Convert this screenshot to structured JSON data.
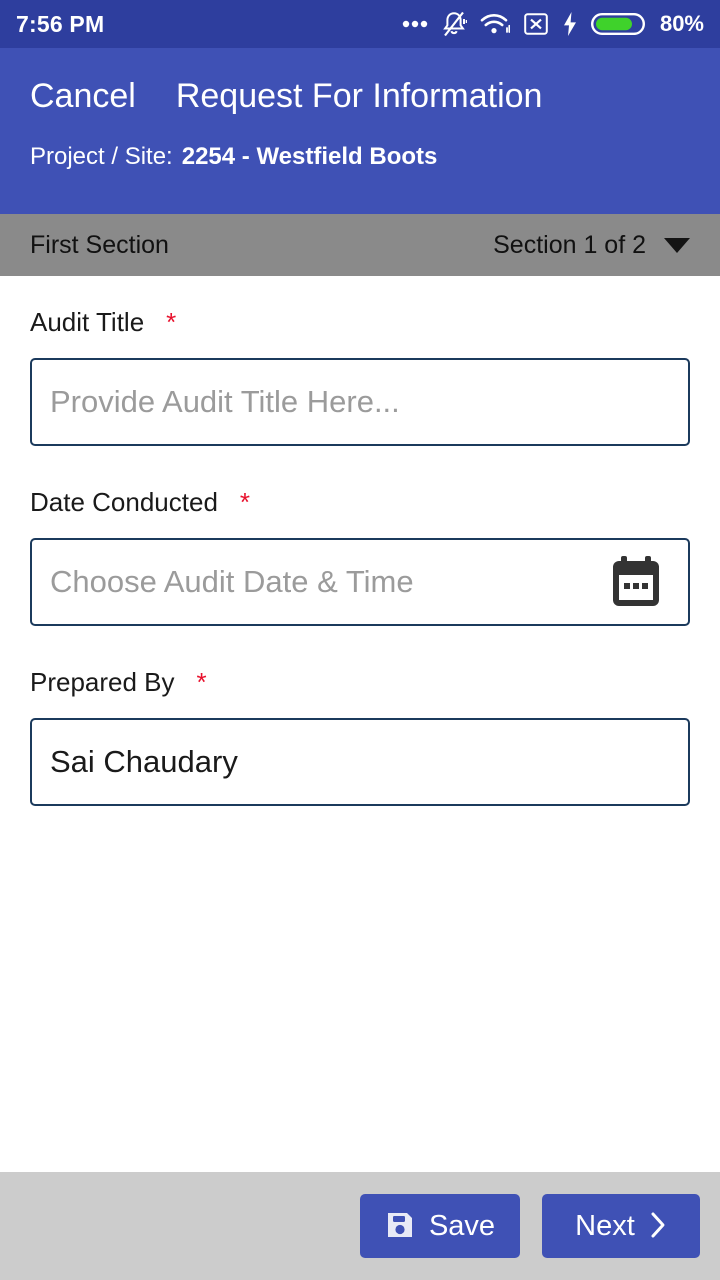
{
  "status_bar": {
    "time": "7:56 PM",
    "battery_percent": "80%",
    "icons": [
      "more-options-icon",
      "notifications-muted-icon",
      "wifi-icon",
      "no-sim-icon",
      "charging-bolt-icon",
      "battery-icon"
    ],
    "colors": {
      "background": "#2E3E9E",
      "battery_fill": "#3FD22B"
    }
  },
  "app_bar": {
    "cancel_label": "Cancel",
    "title": "Request For Information",
    "project_label": "Project / Site:",
    "project_value": "2254 - Westfield Boots",
    "color": "#3F51B5"
  },
  "section_bar": {
    "section_name": "First Section",
    "section_counter": "Section 1 of 2",
    "caret_icon": "chevron-down-icon",
    "color": "#8A8A8A"
  },
  "form": {
    "fields": [
      {
        "label": "Audit Title",
        "required_marker": "*",
        "value": "",
        "placeholder": "Provide Audit Title Here...",
        "has_icon": false
      },
      {
        "label": "Date Conducted",
        "required_marker": "*",
        "value": "",
        "placeholder": "Choose Audit Date & Time",
        "has_icon": true,
        "icon": "calendar-icon"
      },
      {
        "label": "Prepared By",
        "required_marker": "*",
        "value": "Sai Chaudary",
        "placeholder": "",
        "has_icon": false
      }
    ],
    "border_color": "#1B3A5C",
    "required_color": "#E8112D"
  },
  "bottom_bar": {
    "save_label": "Save",
    "save_icon": "save-floppy-icon",
    "next_label": "Next",
    "next_icon": "chevron-right-icon",
    "background": "#CCCCCC",
    "button_color": "#3F51B5"
  }
}
